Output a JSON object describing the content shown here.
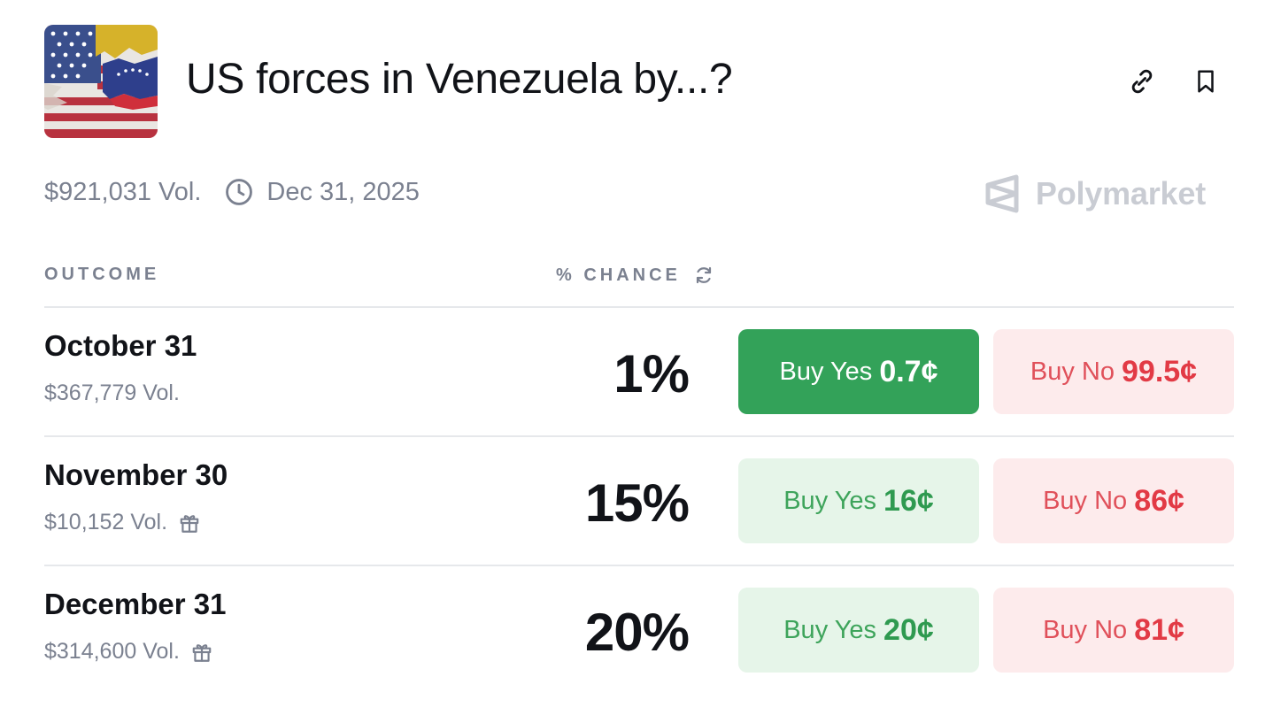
{
  "market": {
    "title": "US forces in Venezuela by...?",
    "volume": "$921,031 Vol.",
    "end_date": "Dec 31, 2025",
    "brand": "Polymarket"
  },
  "icons": {
    "link": "link-icon",
    "bookmark": "bookmark-icon",
    "clock": "clock-icon",
    "refresh": "refresh-icon",
    "gift": "gift-icon",
    "brand": "polymarket-logo"
  },
  "table": {
    "col_outcome": "OUTCOME",
    "col_chance": "% CHANCE"
  },
  "outcomes": [
    {
      "name": "October 31",
      "volume": "$367,779 Vol.",
      "chance": "1%",
      "yes_label": "Buy Yes",
      "yes_price": "0.7¢",
      "no_label": "Buy No",
      "no_price": "99.5¢"
    },
    {
      "name": "November 30",
      "volume": "$10,152 Vol.",
      "chance": "15%",
      "yes_label": "Buy Yes",
      "yes_price": "16¢",
      "no_label": "Buy No",
      "no_price": "86¢"
    },
    {
      "name": "December 31",
      "volume": "$314,600 Vol.",
      "chance": "20%",
      "yes_label": "Buy Yes",
      "yes_price": "20¢",
      "no_label": "Buy No",
      "no_price": "81¢"
    }
  ],
  "colors": {
    "yes_active": "#33a259",
    "yes_bg": "#e6f5e9",
    "no_bg": "#fdebec",
    "no_text": "#e23a45",
    "muted": "#7b8190"
  }
}
